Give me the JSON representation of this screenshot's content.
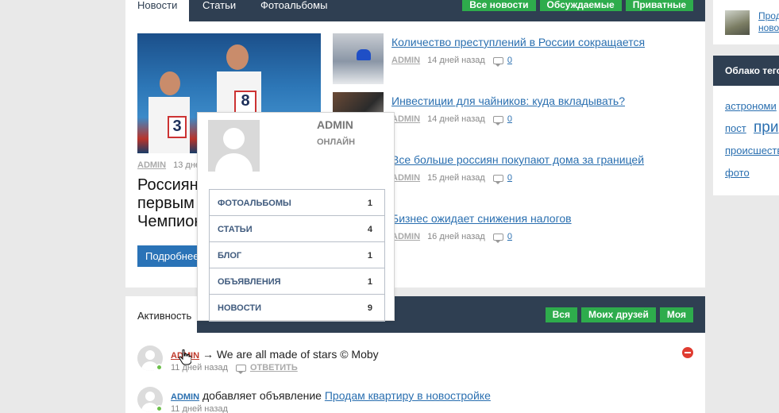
{
  "news": {
    "tabs": [
      "Новости",
      "Статьи",
      "Фотоальбомы"
    ],
    "filters": [
      "Все новости",
      "Обсуждаемые",
      "Приватные"
    ],
    "featured": {
      "image_icon": "runners-photo",
      "author": "ADMIN",
      "date": "13 дней назад",
      "title_lines": [
        "Россиян",
        "первым",
        "Чемпион"
      ],
      "button": "Подробнее",
      "bib_1": "8",
      "bib_2": "3"
    },
    "items": [
      {
        "title": "Количество преступлений в России сокращается",
        "author": "ADMIN",
        "date": "14 дней назад",
        "comments": "0"
      },
      {
        "title": "Инвестиции для чайников: куда вкладывать?",
        "author": "ADMIN",
        "date": "14 дней назад",
        "comments": "0"
      },
      {
        "title": "Все больше россиян покупают дома за границей",
        "author": "ADMIN",
        "date": "15 дней назад",
        "comments": "0"
      },
      {
        "title": "Бизнес ожидает снижения налогов",
        "author": "ADMIN",
        "date": "16 дней назад",
        "comments": "0"
      }
    ]
  },
  "activity": {
    "title": "Активность",
    "filters": [
      "Вся",
      "Моих друзей",
      "Моя"
    ],
    "rows": [
      {
        "author": "ADMIN",
        "text": "→ We are all made of stars © Moby",
        "date": "11 дней назад",
        "reply": "ОТВЕТИТЬ"
      },
      {
        "author": "ADMIN",
        "text": "добавляет объявление",
        "object": "Продам квартиру в новостройке",
        "date": "11 дней назад"
      }
    ]
  },
  "sidebar": {
    "top_link_lines": [
      "Прод",
      "ново"
    ],
    "tags_title": "Облако тегов",
    "tags": [
      "астрономи",
      "пост",
      "при",
      "происшеств",
      "фото"
    ]
  },
  "popover": {
    "name": "ADMIN",
    "status": "ОНЛАЙН",
    "stats": [
      {
        "label": "ФОТОАЛЬБОМЫ",
        "count": "1"
      },
      {
        "label": "СТАТЬИ",
        "count": "4"
      },
      {
        "label": "БЛОГ",
        "count": "1"
      },
      {
        "label": "ОБЪЯВЛЕНИЯ",
        "count": "1"
      },
      {
        "label": "НОВОСТИ",
        "count": "9"
      }
    ]
  },
  "colors": {
    "header": "#2f3f52",
    "accent_green": "#2eac4c",
    "link": "#2a6fb0",
    "button_blue": "#2a73b7",
    "delete_red": "#e03c31"
  }
}
